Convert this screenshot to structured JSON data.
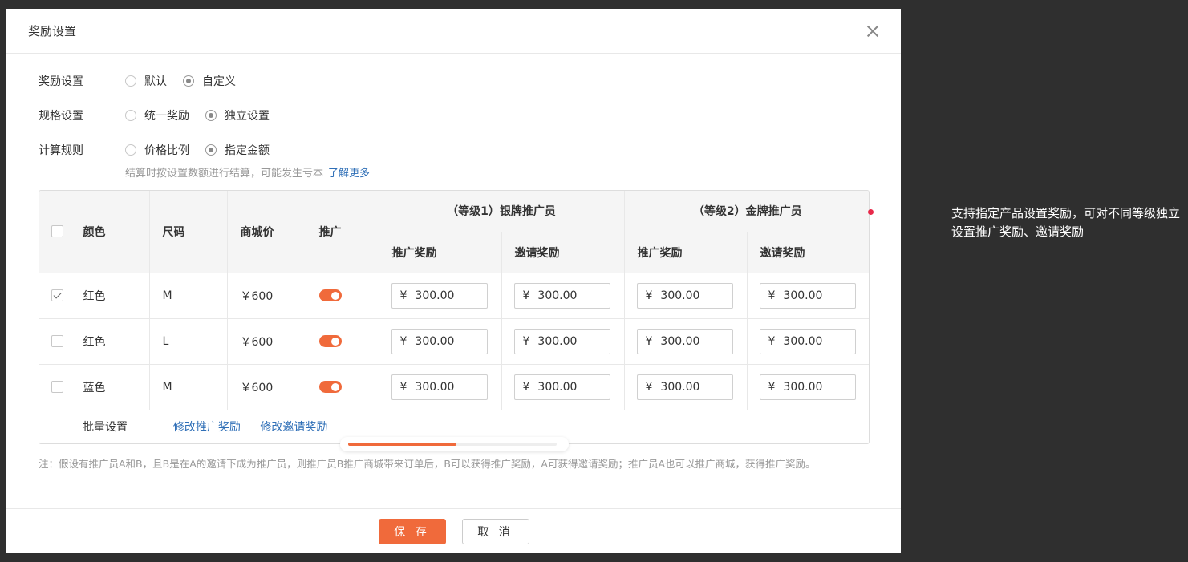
{
  "modal": {
    "title": "奖励设置"
  },
  "form": {
    "reward": {
      "label": "奖励设置",
      "options": [
        "默认",
        "自定义"
      ]
    },
    "spec": {
      "label": "规格设置",
      "options": [
        "统一奖励",
        "独立设置"
      ]
    },
    "calc": {
      "label": "计算规则",
      "options": [
        "价格比例",
        "指定金额"
      ]
    },
    "hint": "结算时按设置数额进行结算，可能发生亏本",
    "hint_link": "了解更多"
  },
  "table": {
    "headers": {
      "color": "颜色",
      "size": "尺码",
      "price": "商城价",
      "promote": "推广",
      "group1": "（等级1）银牌推广员",
      "group2": "（等级2）金牌推广员",
      "promo_reward": "推广奖励",
      "invite_reward": "邀请奖励"
    },
    "rows": [
      {
        "checked": true,
        "color": "红色",
        "size": "M",
        "price": "￥600",
        "promote_on": true,
        "values": [
          "300.00",
          "300.00",
          "300.00",
          "300.00"
        ]
      },
      {
        "checked": false,
        "color": "红色",
        "size": "L",
        "price": "￥600",
        "promote_on": true,
        "values": [
          "300.00",
          "300.00",
          "300.00",
          "300.00"
        ]
      },
      {
        "checked": false,
        "color": "蓝色",
        "size": "M",
        "price": "￥600",
        "promote_on": true,
        "values": [
          "300.00",
          "300.00",
          "300.00",
          "300.00"
        ]
      }
    ],
    "currency": "¥",
    "batch": {
      "label": "批量设置",
      "link1": "修改推广奖励",
      "link2": "修改邀请奖励"
    },
    "scroll_progress": 0.52
  },
  "note": "注：假设有推广员A和B，且B是在A的邀请下成为推广员，则推广员B推广商城带来订单后，B可以获得推广奖励，A可获得邀请奖励；推广员A也可以推广商城，获得推广奖励。",
  "footer": {
    "save": "保 存",
    "cancel": "取 消"
  },
  "annotation": "支持指定产品设置奖励，可对不同等级独立设置推广奖励、邀请奖励",
  "colors": {
    "accent": "#f06a3b",
    "link": "#2f6fb7",
    "annotation": "#e8294a"
  }
}
